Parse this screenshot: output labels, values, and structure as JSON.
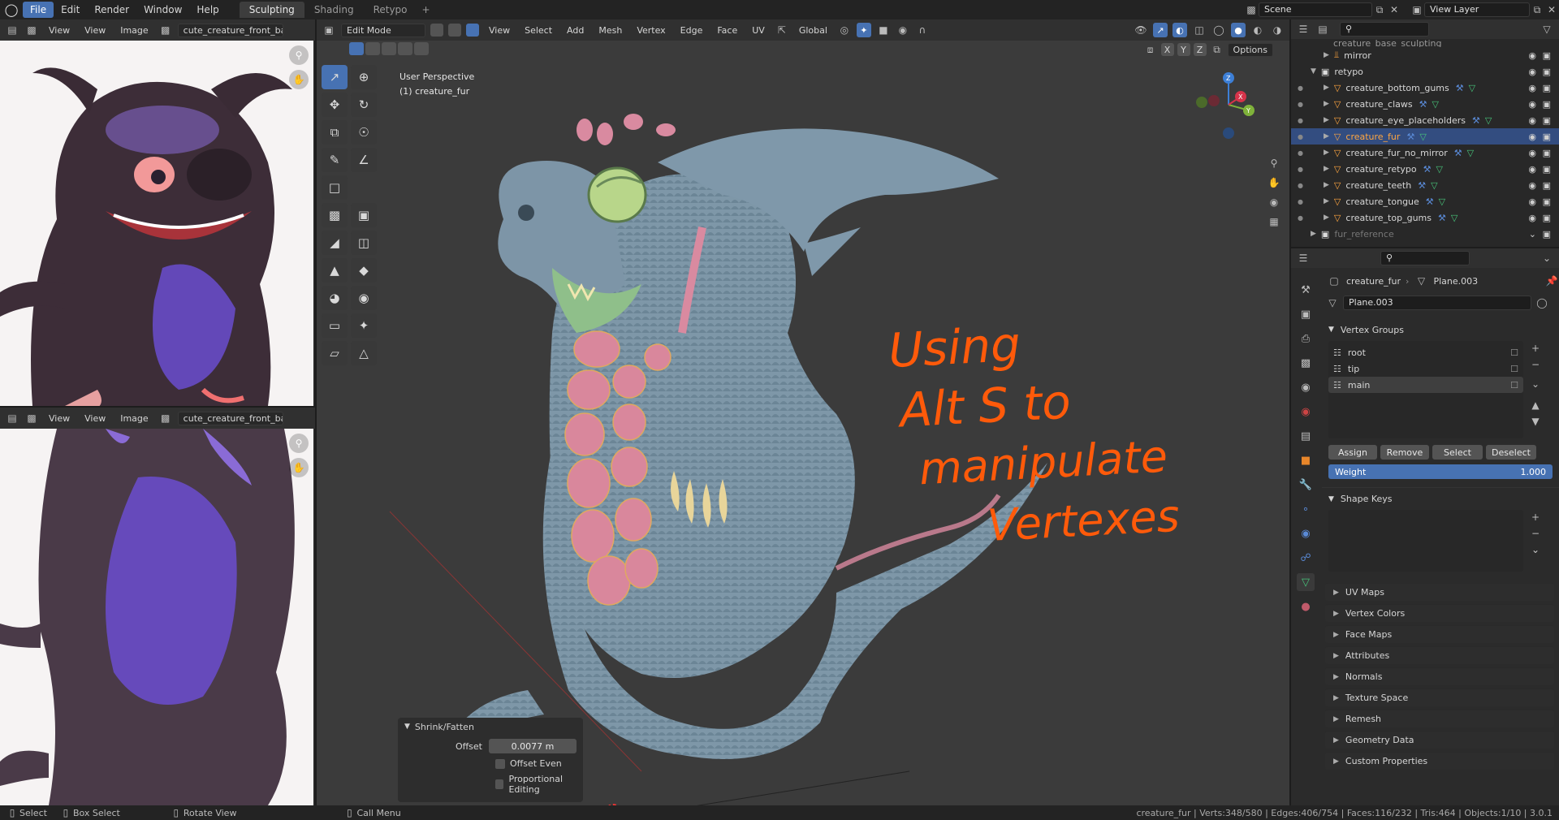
{
  "topbar": {
    "menus": [
      "File",
      "Edit",
      "Render",
      "Window",
      "Help"
    ],
    "workspaces": [
      "Sculpting",
      "Shading",
      "Retypo"
    ],
    "add_tab": "+",
    "scene": "Scene",
    "view_layer": "View Layer"
  },
  "image_editor_top": {
    "menus": [
      "View",
      "View",
      "Image"
    ],
    "image_name": "cute_creature_front_back."
  },
  "image_editor_bottom": {
    "menus": [
      "View",
      "View",
      "Image"
    ],
    "image_name": "cute_creature_front_back."
  },
  "viewport": {
    "mode": "Edit Mode",
    "menus": [
      "View",
      "Select",
      "Add",
      "Mesh",
      "Vertex",
      "Edge",
      "Face",
      "UV"
    ],
    "orientation": "Global",
    "axes": [
      "X",
      "Y",
      "Z"
    ],
    "options": "Options",
    "perspective": "User Perspective",
    "object_label": "(1) creature_fur",
    "annotation_lines": [
      "Using",
      "Alt S to",
      "manipulate",
      "Vertexes"
    ],
    "annotation_color": "#ff5a0a"
  },
  "operator_panel": {
    "title": "Shrink/Fatten",
    "offset_label": "Offset",
    "offset_value": "0.0077 m",
    "offset_even": "Offset Even",
    "proportional": "Proportional Editing"
  },
  "outliner": {
    "top_item": "creature_base_sculpting",
    "rows": [
      {
        "name": "mirror",
        "indent": 2,
        "type": "mod"
      },
      {
        "name": "retypo",
        "indent": 1,
        "type": "collection"
      },
      {
        "name": "creature_bottom_gums",
        "indent": 2,
        "type": "mesh"
      },
      {
        "name": "creature_claws",
        "indent": 2,
        "type": "mesh"
      },
      {
        "name": "creature_eye_placeholders",
        "indent": 2,
        "type": "mesh"
      },
      {
        "name": "creature_fur",
        "indent": 2,
        "type": "mesh",
        "selected": true
      },
      {
        "name": "creature_fur_no_mirror",
        "indent": 2,
        "type": "mesh"
      },
      {
        "name": "creature_retypo",
        "indent": 2,
        "type": "mesh"
      },
      {
        "name": "creature_teeth",
        "indent": 2,
        "type": "mesh"
      },
      {
        "name": "creature_tongue",
        "indent": 2,
        "type": "mesh"
      },
      {
        "name": "creature_top_gums",
        "indent": 2,
        "type": "mesh"
      },
      {
        "name": "fur_reference",
        "indent": 1,
        "type": "collection",
        "dim": true
      }
    ]
  },
  "properties": {
    "breadcrumb_object": "creature_fur",
    "breadcrumb_data": "Plane.003",
    "mesh_name": "Plane.003",
    "vertex_groups_title": "Vertex Groups",
    "vertex_groups": [
      "root",
      "tip",
      "main"
    ],
    "buttons": [
      "Assign",
      "Remove",
      "Select",
      "Deselect"
    ],
    "weight_label": "Weight",
    "weight_value": "1.000",
    "shape_keys_title": "Shape Keys",
    "sections": [
      "UV Maps",
      "Vertex Colors",
      "Face Maps",
      "Attributes",
      "Normals",
      "Texture Space",
      "Remesh",
      "Geometry Data",
      "Custom Properties"
    ]
  },
  "statusbar": {
    "left": [
      "Select",
      "Box Select",
      "Rotate View",
      "Call Menu"
    ],
    "stats": "creature_fur | Verts:348/580 | Edges:406/754 | Faces:116/232 | Tris:464 | Objects:1/10 | 3.0.1"
  }
}
